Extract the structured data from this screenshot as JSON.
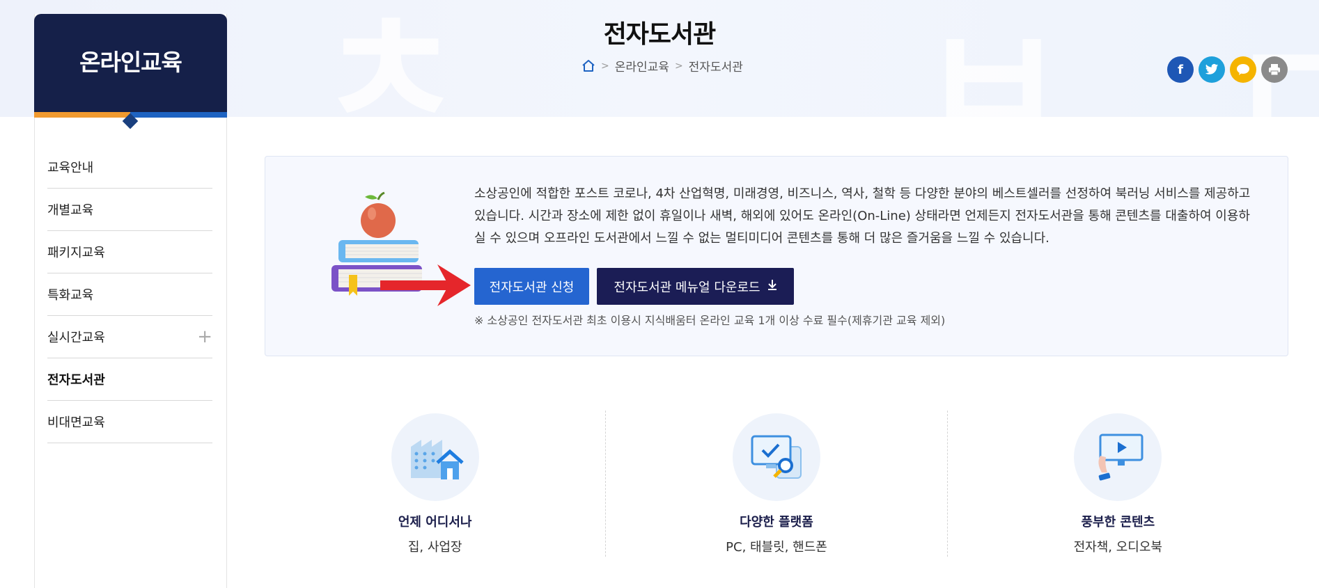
{
  "header": {
    "title": "전자도서관",
    "breadcrumb": [
      "온라인교육",
      "전자도서관"
    ],
    "share_icons": [
      "facebook-icon",
      "twitter-icon",
      "kakaotalk-icon",
      "print-icon"
    ]
  },
  "sidebar": {
    "title": "온라인교육",
    "items": [
      {
        "label": "교육안내"
      },
      {
        "label": "개별교육"
      },
      {
        "label": "패키지교육"
      },
      {
        "label": "특화교육"
      },
      {
        "label": "실시간교육",
        "expandable": true
      },
      {
        "label": "전자도서관",
        "active": true
      },
      {
        "label": "비대면교육"
      }
    ]
  },
  "intro": {
    "text": "소상공인에 적합한 포스트 코로나, 4차 산업혁명, 미래경영, 비즈니스, 역사, 철학 등 다양한 분야의 베스트셀러를 선정하여 북러닝 서비스를 제공하고 있습니다. 시간과 장소에 제한 없이 휴일이나 새벽, 해외에 있어도 온라인(On-Line) 상태라면 언제든지 전자도서관을 통해 콘텐츠를 대출하여 이용하실 수 있으며 오프라인 도서관에서 느낄 수 없는 멀티미디어 콘텐츠를 통해 더 많은 즐거움을 느낄 수 있습니다.",
    "apply_button": "전자도서관 신청",
    "manual_button": "전자도서관 메뉴얼 다운로드",
    "note": "※ 소상공인 전자도서관 최초 이용시 지식배움터 온라인 교육 1개 이상 수료 필수(제휴기관 교육 제외)"
  },
  "features": [
    {
      "title": "언제 어디서나",
      "subtitle": "집, 사업장",
      "icon": "building-home-icon"
    },
    {
      "title": "다양한 플랫폼",
      "subtitle": "PC, 태블릿, 핸드폰",
      "icon": "devices-icon"
    },
    {
      "title": "풍부한 콘텐츠",
      "subtitle": "전자책, 오디오북",
      "icon": "video-play-icon"
    }
  ],
  "colors": {
    "navy": "#152049",
    "blue": "#2565d0",
    "dark_button": "#1b1d55",
    "orange": "#f19a2f",
    "facebook": "#1e57b5",
    "twitter": "#1ea0db",
    "kakao": "#f5b400",
    "print": "#8a8a8a"
  }
}
